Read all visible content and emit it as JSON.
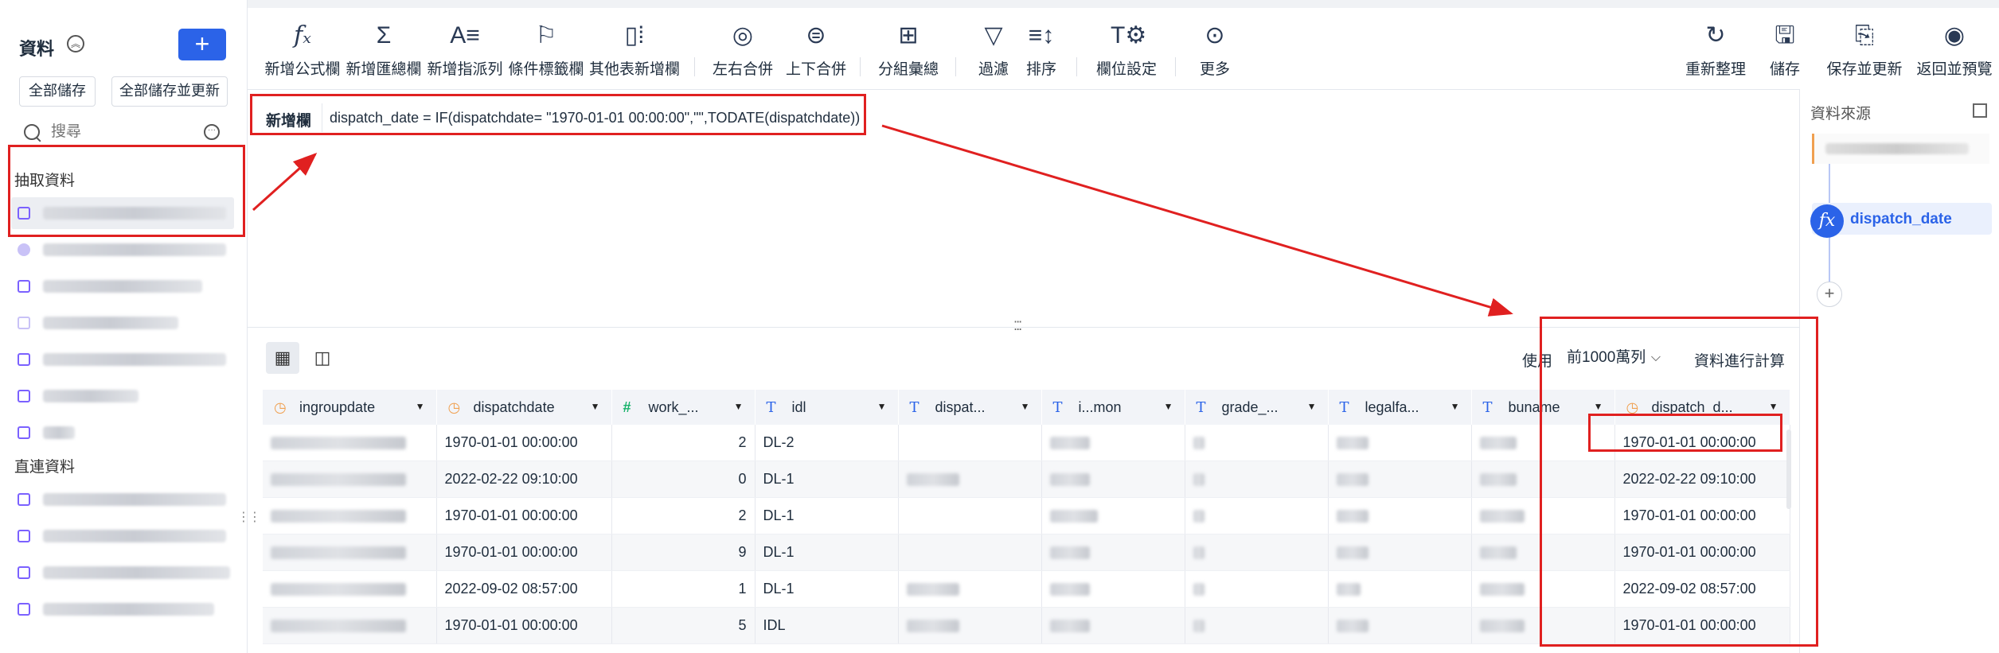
{
  "left_panel": {
    "title": "資料",
    "add_label": "+",
    "save_all": "全部儲存",
    "save_all_update": "全部儲存並更新",
    "search_placeholder": "搜尋",
    "section_extract": "抽取資料",
    "section_direct": "直連資料"
  },
  "toolbar": {
    "items": [
      {
        "label": "新增公式欄",
        "icon": "fx-icon"
      },
      {
        "label": "新增匯總欄",
        "icon": "sigma-icon"
      },
      {
        "label": "新增指派列",
        "icon": "assign-icon"
      },
      {
        "label": "條件標籤欄",
        "icon": "flag-icon"
      },
      {
        "label": "其他表新增欄",
        "icon": "table-add-icon"
      },
      {
        "label": "左右合併",
        "icon": "merge-lr-icon"
      },
      {
        "label": "上下合併",
        "icon": "merge-tb-icon"
      },
      {
        "label": "分組彙總",
        "icon": "group-icon"
      },
      {
        "label": "過濾",
        "icon": "filter-icon"
      },
      {
        "label": "排序",
        "icon": "sort-icon"
      },
      {
        "label": "欄位設定",
        "icon": "field-settings-icon"
      },
      {
        "label": "更多",
        "icon": "more-icon"
      }
    ],
    "right_items": [
      {
        "label": "重新整理",
        "icon": "refresh-icon"
      },
      {
        "label": "儲存",
        "icon": "save-icon"
      },
      {
        "label": "保存並更新",
        "icon": "save-update-icon"
      },
      {
        "label": "返回並預覽",
        "icon": "preview-icon"
      }
    ]
  },
  "formula": {
    "label": "新增欄",
    "text": "dispatch_date = IF(dispatchdate= \"1970-01-01 00:00:00\",\"\",TODATE(dispatchdate))"
  },
  "right_panel": {
    "title": "資料來源",
    "step_label": "dispatch_date",
    "add_label": "+"
  },
  "grid_controls": {
    "use_label": "使用",
    "rows_option": "前1000萬列",
    "calc_label": "資料進行計算"
  },
  "columns": [
    {
      "name": "ingroupdate",
      "type": "date"
    },
    {
      "name": "dispatchdate",
      "type": "date"
    },
    {
      "name": "work_...",
      "type": "number"
    },
    {
      "name": "idl",
      "type": "text"
    },
    {
      "name": "dispat...",
      "type": "text"
    },
    {
      "name": "i...mon",
      "type": "text"
    },
    {
      "name": "grade_...",
      "type": "text"
    },
    {
      "name": "legalfa...",
      "type": "text"
    },
    {
      "name": "buname",
      "type": "text"
    },
    {
      "name": "dispatch_d...",
      "type": "date"
    }
  ],
  "rows": [
    {
      "dispatchdate": "1970-01-01 00:00:00",
      "work": "2",
      "idl": "DL-2",
      "dispatch_date": "1970-01-01 00:00:00"
    },
    {
      "dispatchdate": "2022-02-22 09:10:00",
      "work": "0",
      "idl": "DL-1",
      "dispatch_date": "2022-02-22 09:10:00"
    },
    {
      "dispatchdate": "1970-01-01 00:00:00",
      "work": "2",
      "idl": "DL-1",
      "dispatch_date": "1970-01-01 00:00:00"
    },
    {
      "dispatchdate": "1970-01-01 00:00:00",
      "work": "9",
      "idl": "DL-1",
      "dispatch_date": "1970-01-01 00:00:00"
    },
    {
      "dispatchdate": "2022-09-02 08:57:00",
      "work": "1",
      "idl": "DL-1",
      "dispatch_date": "2022-09-02 08:57:00"
    },
    {
      "dispatchdate": "1970-01-01 00:00:00",
      "work": "5",
      "idl": "IDL",
      "dispatch_date": "1970-01-01 00:00:00"
    }
  ],
  "colors": {
    "accent": "#2b63e8",
    "annotation": "#e02020",
    "date_icon": "#f0a050",
    "number_icon": "#17b26a"
  }
}
